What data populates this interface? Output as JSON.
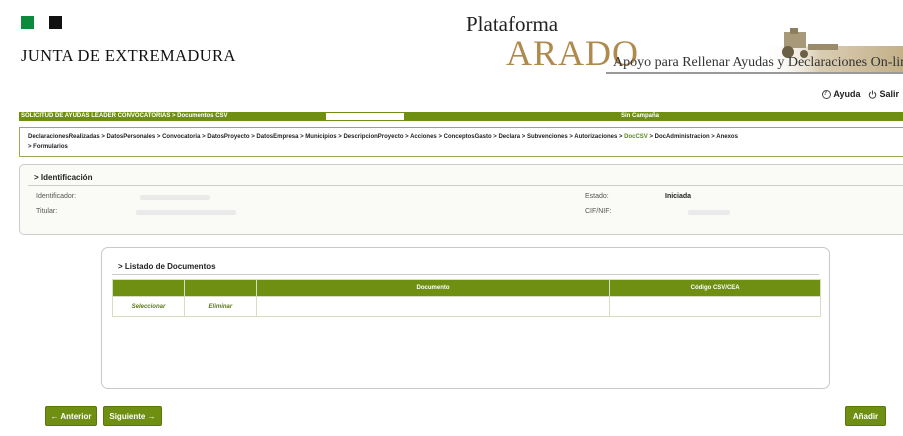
{
  "header": {
    "org_name": "JUNTA DE EXTREMADURA",
    "platform_word": "Plataforma",
    "platform_name": "ARADO",
    "tagline": "Apoyo para Rellenar Ayudas y Declaraciones On-line",
    "help_label": "Ayuda",
    "exit_label": "Salir",
    "help_icon": "question-circle-icon",
    "exit_icon": "power-icon"
  },
  "topbar": {
    "left_text": "SOLICITUD DE AYUDAS LEADER CONVOCATORIAS > Documentos CSV",
    "right_text": "Sin Campaña"
  },
  "breadcrumb": {
    "line1_before": "DeclaracionesRealizadas > DatosPersonales > Convocatoria > DatosProyecto > DatosEmpresa > Municipios > DescripcionProyecto > Acciones > ConceptosGasto > Declara > Subvenciones > Autorizaciones > ",
    "active": "DocCSV",
    "line1_after": " > DocAdministracion > Anexos",
    "line2": "> Formularios"
  },
  "identificacion": {
    "title": "> Identificación",
    "identificador_label": "Identificador:",
    "titular_label": "Titular:",
    "estado_label": "Estado:",
    "estado_value": "Iniciada",
    "cif_label": "CIF/NIF:"
  },
  "listado": {
    "title": "> Listado de Documentos",
    "columns": [
      "",
      "",
      "Documento",
      "Código CSV/CEA"
    ],
    "rows": [
      {
        "seleccionar": "Seleccionar",
        "eliminar": "Eliminar",
        "documento": "",
        "codigo": ""
      }
    ]
  },
  "buttons": {
    "anterior": "← Anterior",
    "siguiente": "Siguiente →",
    "anadir": "Añadir"
  },
  "colors": {
    "accent": "#6f8f12",
    "brand_gold": "#b0894c",
    "logo_green": "#0a8a3a"
  }
}
